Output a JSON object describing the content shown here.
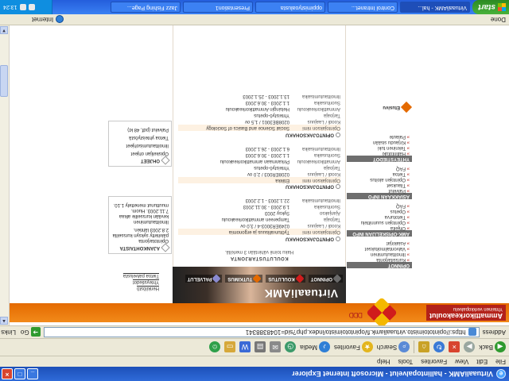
{
  "window": {
    "title": "VirtuaaliAMK - hallintopalvelut - Microsoft Internet Explorer",
    "minimize": "_",
    "maximize": "□",
    "close": "×"
  },
  "menu": [
    "File",
    "Edit",
    "View",
    "Favorites",
    "Tools",
    "Help"
  ],
  "toolbar": {
    "back": "Back",
    "search": "Search",
    "favorites": "Favorites",
    "media": "Media"
  },
  "address": {
    "label": "Address",
    "url": "https://opintotoimisto.virtuaaliamk.fi/opintotoimisto/index.php?sid=1048388341",
    "go": "Go",
    "links": "Links"
  },
  "site": {
    "brand": "Ammattikorkeakoulut",
    "brand_sub": "Yhteinen verkkopalvelu",
    "logo_arrows": "DDD",
    "hero_title": "VirtuaaliAMK",
    "hero_tabs": [
      {
        "label": "OPINNOT",
        "color": "#6a6a6a"
      },
      {
        "label": "KOULUTUS",
        "color": "#d01c1c"
      },
      {
        "label": "TUTKIMUS",
        "color": "#e46a00"
      },
      {
        "label": "PALVELUT",
        "color": "#8a8ad0"
      }
    ]
  },
  "sidebar_links": [
    "Henkilöstö",
    "Yhteystiedot",
    "Tietoa palvelusta"
  ],
  "news_box": {
    "title": "AJANKOHTAISTA",
    "items": [
      {
        "lines": [
          "Opintotarjonta",
          "päivitetty syksyn kursseilla",
          "2.8.2003 lähtien."
        ]
      },
      {
        "lines": [
          "Ilmoittautuminen",
          "kevään kursseille alkaa",
          "7.11.2003. Huom.",
          "muuttunut menettely 1.10."
        ]
      }
    ]
  },
  "help_box": {
    "title": "OHJEET",
    "items": [
      "Opiskelijan ohjeet",
      "Ilmoittautumisohjeet",
      "Tietoa yhteistyöstä",
      "Palvelut (pdf, 48 kt)"
    ]
  },
  "main": {
    "section_title": "KOULUTUSTARJONTA",
    "section_sub": "Haku toimii vähintään 3 merkillä.",
    "col_head": "OPINTOJAKSOHAKU",
    "courses": [
      {
        "name": "Ilmoittautumisaika",
        "rows": [
          {
            "k": "Opintojakson nimi",
            "v": "Työturvallisuus ja ergonomia"
          },
          {
            "k": "Koodi / Laajuus",
            "v": "0249ER3003-4 / 3,0 ov"
          },
          {
            "k": "Tarjoaja",
            "v": "Tampereen ammattikorkeakoulu"
          },
          {
            "k": "Ajanjakso",
            "v": "Syksy 2003"
          },
          {
            "k": "Suoritusaika",
            "v": "1.9.2003 - 30.11.2003"
          },
          {
            "k": "Ilmoittautumisaika",
            "v": "22.1.2003 - 1.2.2003"
          }
        ]
      },
      {
        "name": "Ilmoittautumisaika",
        "rows": [
          {
            "k": "Opintojakson nimi",
            "v": "Etiikka"
          },
          {
            "k": "Koodi / Laajuus",
            "v": "0208ER003 / 2,0 ov"
          },
          {
            "k": "Tarjoaja",
            "v": "Yhteistyö-opetus"
          },
          {
            "k": "Ammattikorkeakoulu",
            "v": "Pirkanmaan ammattikorkeakoulu"
          },
          {
            "k": "Suoritusaika",
            "v": "1.1.2003 - 30.6.2003"
          },
          {
            "k": "Ilmoittautumisaika",
            "v": "6.1.2003 - 26.1.2003"
          }
        ]
      },
      {
        "name": "Ilmoittautumisaika",
        "rows": [
          {
            "k": "Opintojakson nimi",
            "v": "Social Science and Basics of Sociology"
          },
          {
            "k": "Koodi / Laajuus",
            "v": "0208BE3001 / 1,5 ov"
          },
          {
            "k": "Tarjoaja",
            "v": "Yhteistyö-opetus"
          },
          {
            "k": "Ammattikorkeakoulu",
            "v": "Helsingin Ammattikorkeakoulu"
          },
          {
            "k": "Suoritusaika",
            "v": "1.1.2003 - 30.6.2003"
          },
          {
            "k": "Ilmoittautumisaika",
            "v": "13.1.2003 - 25.1.2003"
          }
        ]
      }
    ]
  },
  "nav": [
    {
      "title": "OPINNOT",
      "items": [
        "Kurssitarjonta",
        "Ilmoittautuminen",
        "Valvontailmoitukset",
        "Asiakirjat"
      ]
    },
    {
      "title": "AMK-OPISKELIJAN INFO",
      "items": [
        "Ohjeita",
        "Opintojen suunnittelu",
        "Tietoturva",
        "Opetus",
        "FAQ"
      ]
    },
    {
      "title": "ASIAKKAAN INFO",
      "items": [
        "Palvelut",
        "Tilaukset",
        "Opintojen aloitus",
        "Tietoa",
        "FAQ"
      ]
    },
    {
      "title": "YHTEYSTIEDOT",
      "items": [
        "Hallintotuki",
        "Tekninen tuki",
        "Kirjaudu sisään",
        "Palaute"
      ]
    }
  ],
  "enter_label": "Etusivu",
  "status": {
    "text": "Done",
    "zone": "Internet"
  },
  "taskbar": {
    "start": "start",
    "tasks": [
      "VirtuaaliAMK - hal...",
      "Control Intranet...",
      "oppimistyoalusta",
      "Presentation1",
      "Jazz Fishing Page..."
    ],
    "clock": "13:24"
  }
}
